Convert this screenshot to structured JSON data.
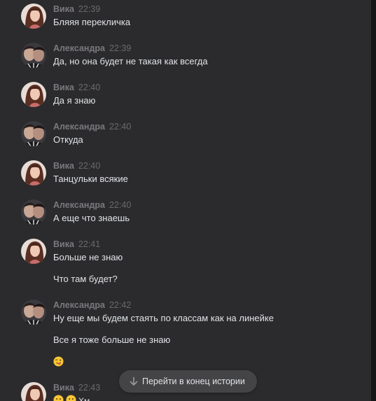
{
  "users": {
    "vika": {
      "name": "Вика"
    },
    "alexandra": {
      "name": "Александра"
    }
  },
  "messages": [
    {
      "author": "Вика",
      "time": "22:39",
      "lines": [
        "Бляяя перекличка"
      ]
    },
    {
      "author": "Александра",
      "time": "22:39",
      "lines": [
        "Да, но она будет не такая как всегда"
      ]
    },
    {
      "author": "Вика",
      "time": "22:40",
      "lines": [
        "Да я знаю"
      ]
    },
    {
      "author": "Александра",
      "time": "22:40",
      "lines": [
        "Откуда"
      ]
    },
    {
      "author": "Вика",
      "time": "22:40",
      "lines": [
        "Танцульки всякие"
      ]
    },
    {
      "author": "Александра",
      "time": "22:40",
      "lines": [
        "А еще что знаешь"
      ]
    },
    {
      "author": "Вика",
      "time": "22:41",
      "lines": [
        "Больше не знаю",
        "Что там будет?"
      ]
    },
    {
      "author": "Александра",
      "time": "22:42",
      "lines": [
        "Ну еще мы будем стаять по классам как на линейке",
        "Все я тоже больше не знаю"
      ],
      "emoji": "winking-tongue-emoji"
    },
    {
      "author": "Вика",
      "time": "22:43",
      "lines": [],
      "emoji": "thinking-emoji",
      "tail_text": "Хм"
    }
  ],
  "scroll_button": {
    "label": "Перейти в конец истории",
    "icon": "arrow-down-icon"
  },
  "colors": {
    "background": "#2b2b2d",
    "text": "#e1e3e6",
    "name": "#7a7a7e",
    "time": "#6a6a6e",
    "button_bg": "#444446"
  }
}
